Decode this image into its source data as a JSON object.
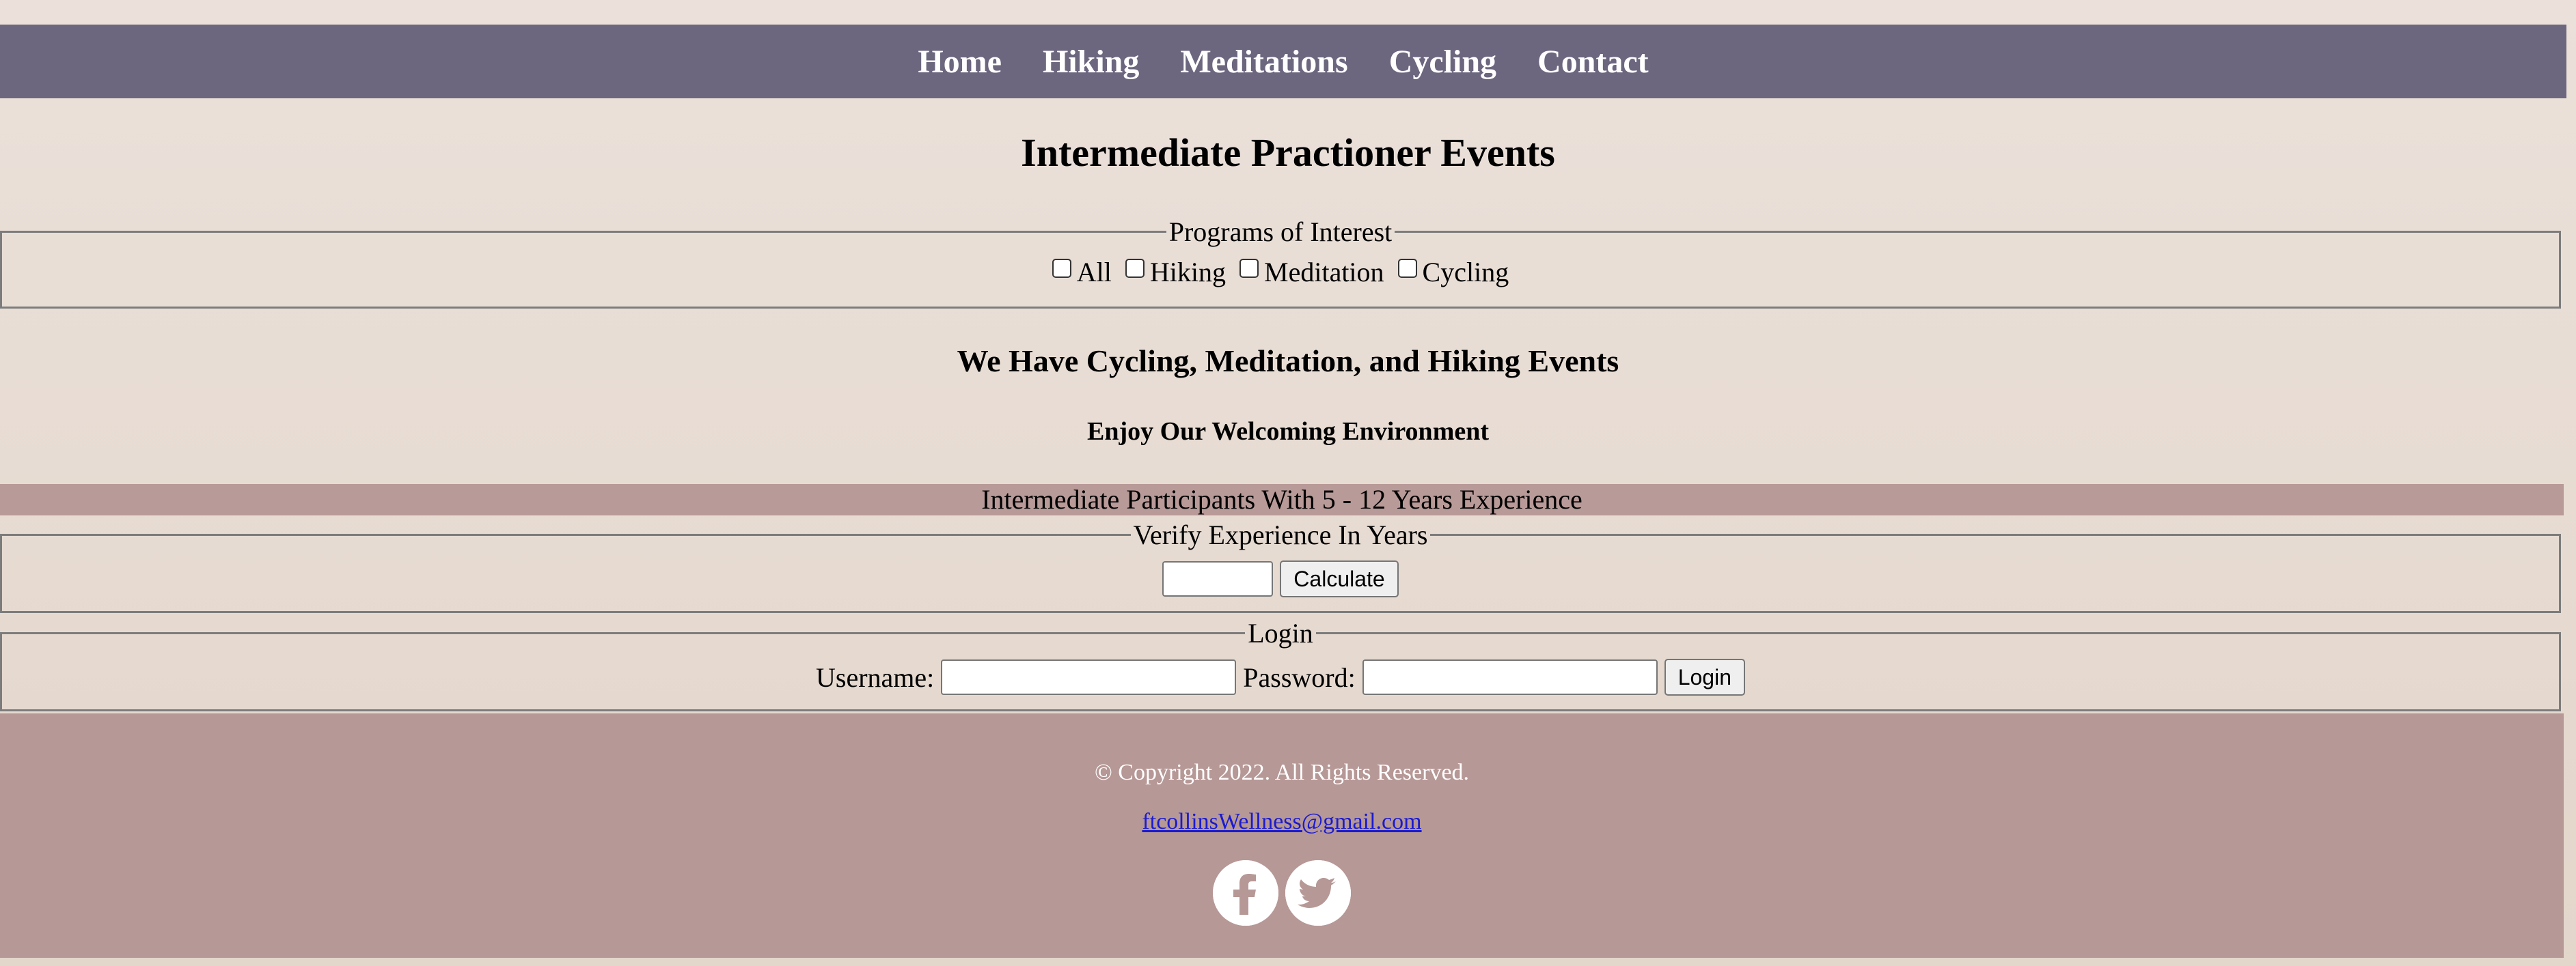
{
  "nav": {
    "items": [
      {
        "label": "Home"
      },
      {
        "label": "Hiking"
      },
      {
        "label": "Meditations"
      },
      {
        "label": "Cycling"
      },
      {
        "label": "Contact"
      }
    ]
  },
  "main": {
    "title": "Intermediate Practioner Events",
    "programs": {
      "legend": "Programs of Interest",
      "options": [
        {
          "label": "All",
          "checked": false
        },
        {
          "label": "Hiking",
          "checked": false
        },
        {
          "label": "Meditation",
          "checked": false
        },
        {
          "label": "Cycling",
          "checked": false
        }
      ]
    },
    "subtitle": "We Have Cycling, Meditation, and Hiking Events",
    "tagline": "Enjoy Our Welcoming Environment",
    "banner": "Intermediate Participants With 5 - 12 Years Experience",
    "verify": {
      "legend": "Verify Experience In Years",
      "input_value": "",
      "button_label": "Calculate"
    },
    "login": {
      "legend": "Login",
      "username_label": "Username:",
      "username_value": "",
      "password_label": "Password:",
      "password_value": "",
      "button_label": "Login"
    }
  },
  "footer": {
    "copyright": "© Copyright 2022. All Rights Reserved.",
    "email": "ftcollinsWellness@gmail.com",
    "social": [
      "facebook-icon",
      "twitter-icon"
    ]
  },
  "colors": {
    "nav_bg": "#6c667f",
    "banner_bg": "#b89a98",
    "footer_bg": "#b69896",
    "page_bg": "#ebe1da",
    "link": "#1a1ad0"
  }
}
